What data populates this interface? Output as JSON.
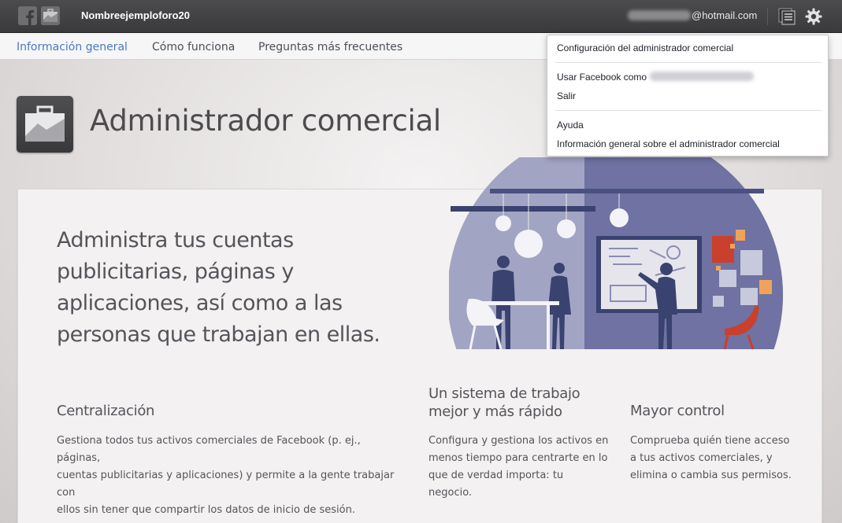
{
  "topbar": {
    "account_name": "Nombreejemploforo20",
    "email_domain": "@hotmail.com",
    "icons": [
      "facebook-logo-icon",
      "briefcase-icon",
      "list-icon",
      "gear-icon"
    ]
  },
  "tabs": [
    {
      "label": "Información general",
      "active": true
    },
    {
      "label": "Cómo funciona",
      "active": false
    },
    {
      "label": "Preguntas más frecuentes",
      "active": false
    }
  ],
  "header": {
    "title": "Administrador comercial"
  },
  "hero": {
    "line1": "Administra tus cuentas",
    "line2": "publicitarias, páginas y",
    "line3": "aplicaciones, así como a las",
    "line4": "personas que trabajan en ellas."
  },
  "columns": [
    {
      "title_line1": "Centralización",
      "title_line2": "",
      "text_line1": "Gestiona todos tus activos comerciales de Facebook (p. ej., páginas,",
      "text_line2": "cuentas publicitarias y aplicaciones) y permite a la gente trabajar con",
      "text_line3": "ellos sin tener que compartir los datos de inicio de sesión."
    },
    {
      "title_line1": "Un sistema de trabajo",
      "title_line2": "mejor y más rápido",
      "text_line1": "Configura y gestiona los activos en",
      "text_line2": "menos tiempo para centrarte en lo",
      "text_line3": "que de verdad importa: tu negocio."
    },
    {
      "title_line1": "Mayor control",
      "title_line2": "",
      "text_line1": "Comprueba quién tiene acceso",
      "text_line2": "a tus activos comerciales, y",
      "text_line3": "elimina o cambia sus permisos."
    }
  ],
  "dropdown": {
    "settings": "Configuración del administrador comercial",
    "use_as": "Usar Facebook como",
    "logout": "Salir",
    "help": "Ayuda",
    "overview": "Información general sobre el administrador comercial"
  },
  "colors": {
    "topbar": "#3f3e40",
    "accent": "#4a78c4",
    "illustration_blue": "#6f72a2",
    "illustration_dark": "#3a4270",
    "illustration_red": "#c9402c",
    "illustration_orange": "#f0a25b"
  }
}
